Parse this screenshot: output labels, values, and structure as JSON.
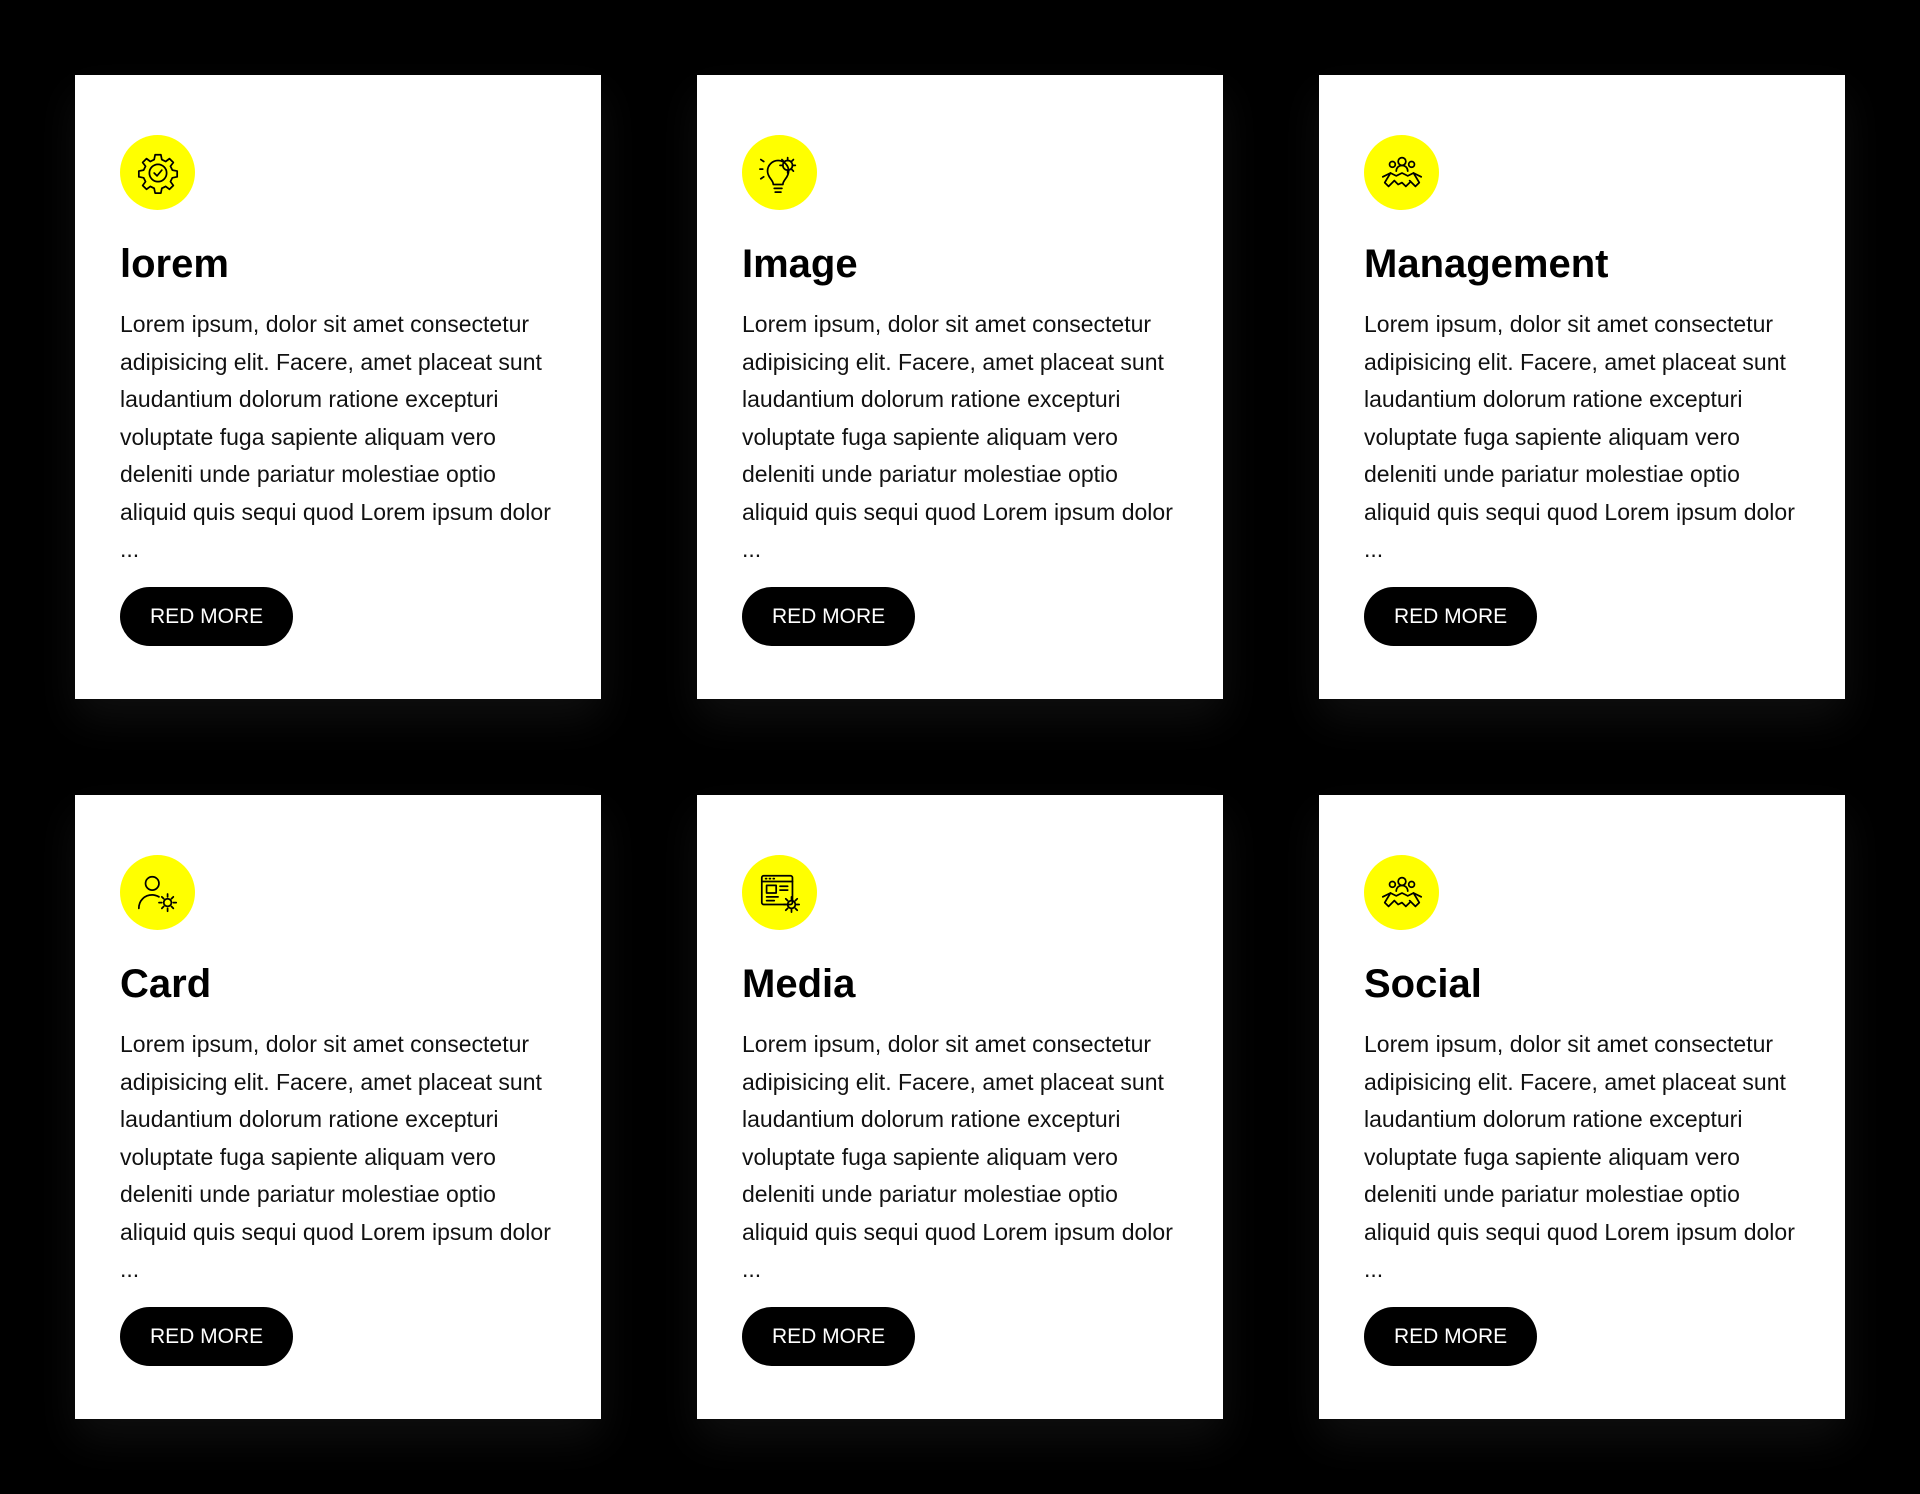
{
  "colors": {
    "background": "#000000",
    "card": "#ffffff",
    "accent": "#ffff00",
    "button": "#000000",
    "button_text": "#ffffff"
  },
  "cards": [
    {
      "icon": "gear-check-icon",
      "title": "lorem",
      "text": "Lorem ipsum, dolor sit amet consectetur adipisicing elit. Facere, amet placeat sunt laudantium dolorum ratione excepturi voluptate fuga sapiente aliquam vero deleniti unde pariatur molestiae optio aliquid quis sequi quod Lorem ipsum dolor ...",
      "button": "RED MORE"
    },
    {
      "icon": "lightbulb-gear-icon",
      "title": "Image",
      "text": "Lorem ipsum, dolor sit amet consectetur adipisicing elit. Facere, amet placeat sunt laudantium dolorum ratione excepturi voluptate fuga sapiente aliquam vero deleniti unde pariatur molestiae optio aliquid quis sequi quod Lorem ipsum dolor ...",
      "button": "RED MORE"
    },
    {
      "icon": "handshake-team-icon",
      "title": "Management",
      "text": "Lorem ipsum, dolor sit amet consectetur adipisicing elit. Facere, amet placeat sunt laudantium dolorum ratione excepturi voluptate fuga sapiente aliquam vero deleniti unde pariatur molestiae optio aliquid quis sequi quod Lorem ipsum dolor ...",
      "button": "RED MORE"
    },
    {
      "icon": "user-settings-icon",
      "title": "Card",
      "text": "Lorem ipsum, dolor sit amet consectetur adipisicing elit. Facere, amet placeat sunt laudantium dolorum ratione excepturi voluptate fuga sapiente aliquam vero deleniti unde pariatur molestiae optio aliquid quis sequi quod Lorem ipsum dolor ...",
      "button": "RED MORE"
    },
    {
      "icon": "web-settings-icon",
      "title": "Media",
      "text": "Lorem ipsum, dolor sit amet consectetur adipisicing elit. Facere, amet placeat sunt laudantium dolorum ratione excepturi voluptate fuga sapiente aliquam vero deleniti unde pariatur molestiae optio aliquid quis sequi quod Lorem ipsum dolor ...",
      "button": "RED MORE"
    },
    {
      "icon": "handshake-team-icon",
      "title": "Social",
      "text": "Lorem ipsum, dolor sit amet consectetur adipisicing elit. Facere, amet placeat sunt laudantium dolorum ratione excepturi voluptate fuga sapiente aliquam vero deleniti unde pariatur molestiae optio aliquid quis sequi quod Lorem ipsum dolor ...",
      "button": "RED MORE"
    }
  ]
}
